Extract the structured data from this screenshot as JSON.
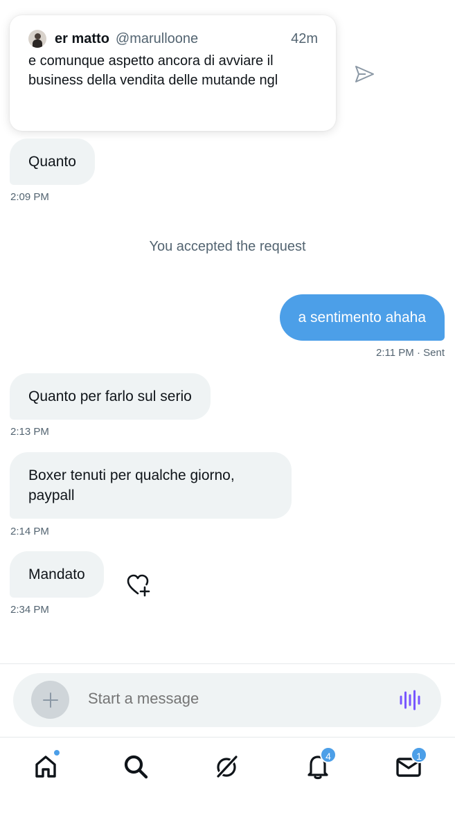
{
  "quoted_tweet": {
    "name": "er matto",
    "handle": "@marulloone",
    "time": "42m",
    "text": "e comunque aspetto ancora di avviare il business della vendita delle mutande ngl"
  },
  "messages": [
    {
      "text": "Quanto",
      "time": "2:09 PM"
    },
    {
      "system": "You accepted the request"
    },
    {
      "text": "a sentimento ahaha",
      "time": "2:11 PM",
      "status": "· Sent"
    },
    {
      "text": "Quanto per farlo sul serio",
      "time": "2:13 PM"
    },
    {
      "text": "Boxer tenuti per qualche giorno, paypall",
      "time": "2:14 PM"
    },
    {
      "text": "Mandato",
      "time": "2:34 PM"
    }
  ],
  "composer": {
    "placeholder": "Start a message"
  },
  "nav": {
    "notifications_badge": "4",
    "messages_badge": "1"
  },
  "colors": {
    "accent": "#4c9fe8",
    "incoming_bubble": "#eff3f4",
    "secondary_text": "#536471",
    "voice_icon": "#7856ff"
  }
}
